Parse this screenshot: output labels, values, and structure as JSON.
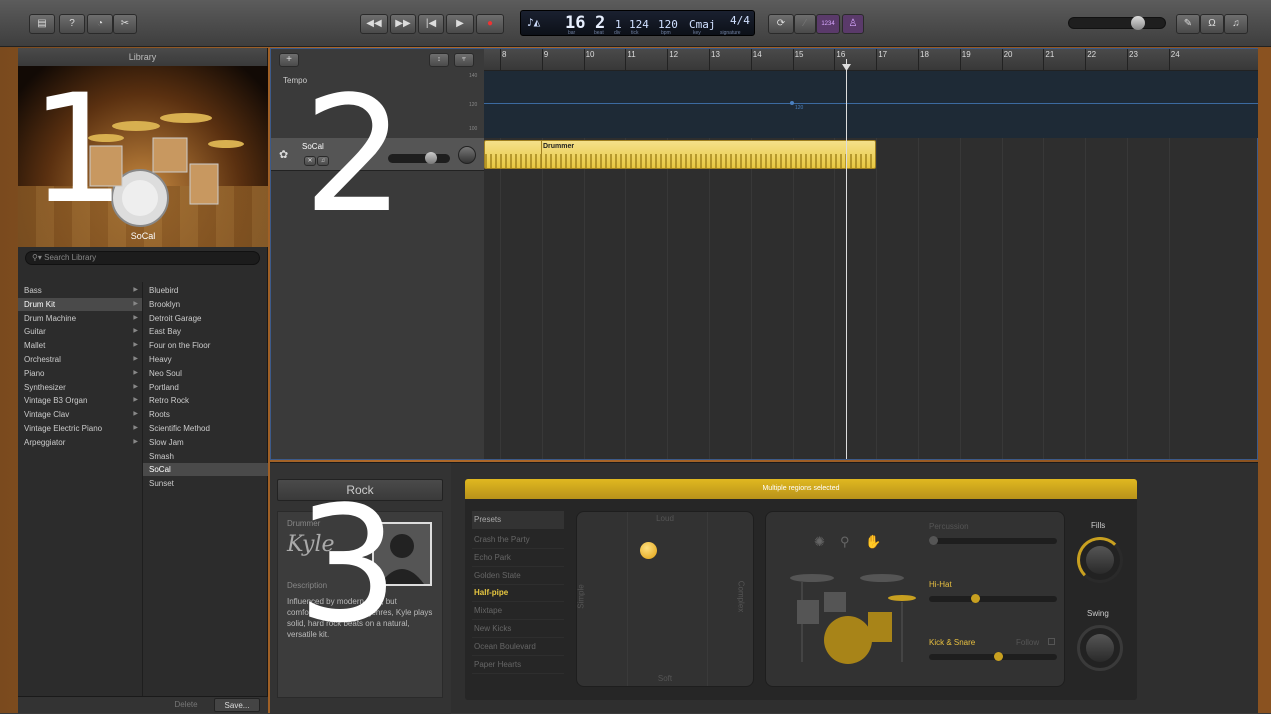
{
  "toolbar": {
    "lcd": {
      "bar": "16",
      "beat": "2",
      "div": "1",
      "tick": "124",
      "bpm": "120",
      "key": "Cmaj",
      "signature": "4/4",
      "labels": {
        "bar": "bar",
        "beat": "beat",
        "div": "div",
        "tick": "tick",
        "bpm": "bpm",
        "key": "key",
        "signature": "signature"
      }
    },
    "count_in": "1234"
  },
  "library": {
    "title": "Library",
    "image_caption": "SoCal",
    "search_placeholder": "Search Library",
    "categories": [
      "Bass",
      "Drum Kit",
      "Drum Machine",
      "Guitar",
      "Mallet",
      "Orchestral",
      "Piano",
      "Synthesizer",
      "Vintage B3 Organ",
      "Vintage Clav",
      "Vintage Electric Piano",
      "Arpeggiator"
    ],
    "selected_category": "Drum Kit",
    "kits": [
      "Bluebird",
      "Brooklyn",
      "Detroit Garage",
      "East Bay",
      "Four on the Floor",
      "Heavy",
      "Neo Soul",
      "Portland",
      "Retro Rock",
      "Roots",
      "Scientific Method",
      "Slow Jam",
      "Smash",
      "SoCal",
      "Sunset"
    ],
    "selected_kit": "SoCal",
    "delete_label": "Delete",
    "save_label": "Save..."
  },
  "tracks": {
    "add_label": "+",
    "ruler_bars": [
      "8",
      "9",
      "10",
      "11",
      "12",
      "13",
      "14",
      "15",
      "16",
      "17",
      "18",
      "19",
      "20",
      "21",
      "22",
      "23",
      "24"
    ],
    "tempo_label": "Tempo",
    "tempo_scale": [
      "140",
      "120",
      "100"
    ],
    "tempo_point_label": "120",
    "track_name": "SoCal",
    "region_title": "Drummer"
  },
  "editor": {
    "title": "Rock",
    "drummer_label": "Drummer",
    "drummer_name": "Kyle",
    "description_label": "Description",
    "description_text": "Influenced by modern rock, but comfortable with most genres, Kyle plays solid, hard rock beats on a natural, versatile kit.",
    "banner": "Multiple regions selected",
    "presets_label": "Presets",
    "presets": [
      "Crash the Party",
      "Echo Park",
      "Golden State",
      "Half-pipe",
      "Mixtape",
      "New Kicks",
      "Ocean Boulevard",
      "Paper Hearts"
    ],
    "selected_preset": "Half-pipe",
    "xy": {
      "top": "Loud",
      "bottom": "Soft",
      "left": "Simple",
      "right": "Complex"
    },
    "percussion_label": "Percussion",
    "hihat_label": "Hi-Hat",
    "kick_label": "Kick & Snare",
    "follow_label": "Follow",
    "fills_label": "Fills",
    "swing_label": "Swing",
    "hihat_level": 0.35,
    "kick_level": 0.55
  },
  "overlays": {
    "one": "1",
    "two": "2",
    "three": "3"
  },
  "colors": {
    "accent": "#e8c840",
    "selection": "#3c5a8a",
    "record": "#e33333"
  }
}
